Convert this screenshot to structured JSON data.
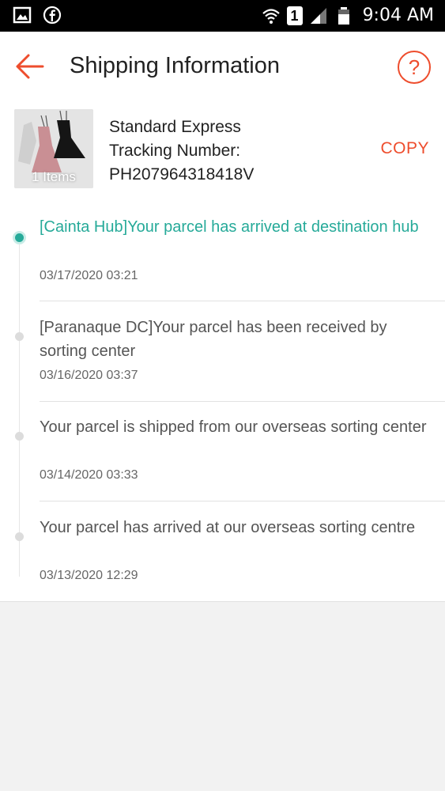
{
  "status_bar": {
    "time": "9:04 AM",
    "sim_slot": "1",
    "icons": [
      "gallery-icon",
      "facebook-icon",
      "wifi-icon",
      "signal-icon",
      "battery-icon"
    ]
  },
  "header": {
    "title": "Shipping Information",
    "help_label": "?"
  },
  "shipment": {
    "thumbnail_label": "1 Items",
    "carrier": "Standard Express",
    "tracking_label": "Tracking Number:",
    "tracking_number": "PH207964318418V",
    "copy_label": "COPY"
  },
  "events": [
    {
      "text": "[Cainta Hub]Your parcel has arrived at destination hub",
      "time": "03/17/2020 03:21",
      "active": true
    },
    {
      "text": "[Paranaque DC]Your parcel has been received by sorting center",
      "time": "03/16/2020 03:37",
      "active": false
    },
    {
      "text": "Your parcel is shipped from our overseas sorting center",
      "time": "03/14/2020 03:33",
      "active": false
    },
    {
      "text": "Your parcel has arrived at our overseas sorting centre",
      "time": "03/13/2020 12:29",
      "active": false
    }
  ],
  "colors": {
    "accent": "#ee4d2d",
    "active_event": "#26aa99"
  }
}
